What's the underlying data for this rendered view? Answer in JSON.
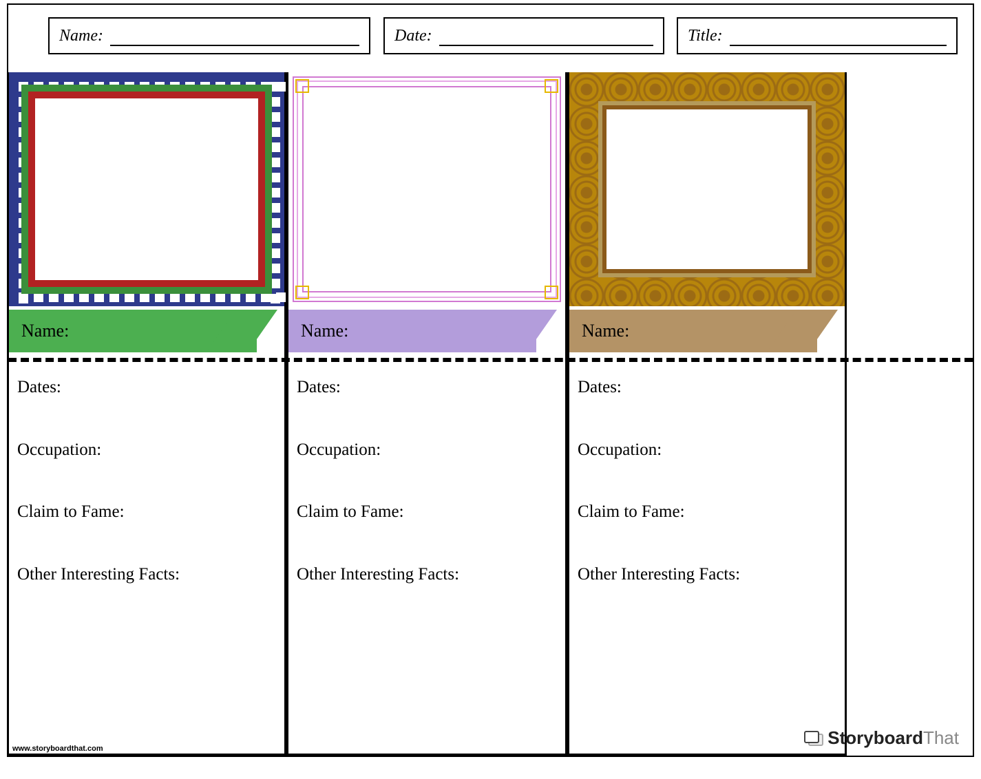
{
  "header": {
    "name_label": "Name:",
    "date_label": "Date:",
    "title_label": "Title:"
  },
  "columns": [
    {
      "name_label": "Name:",
      "dates_label": "Dates:",
      "occupation_label": "Occupation:",
      "claim_label": "Claim to Fame:",
      "facts_label": "Other Interesting Facts:",
      "banner_color": "#4caf50"
    },
    {
      "name_label": "Name:",
      "dates_label": "Dates:",
      "occupation_label": "Occupation:",
      "claim_label": "Claim to Fame:",
      "facts_label": "Other Interesting Facts:",
      "banner_color": "#b39ddb"
    },
    {
      "name_label": "Name:",
      "dates_label": "Dates:",
      "occupation_label": "Occupation:",
      "claim_label": "Claim to Fame:",
      "facts_label": "Other Interesting Facts:",
      "banner_color": "#b49366"
    }
  ],
  "footer": {
    "url": "www.storyboardthat.com",
    "brand_bold": "Storyboard",
    "brand_light": "That"
  }
}
